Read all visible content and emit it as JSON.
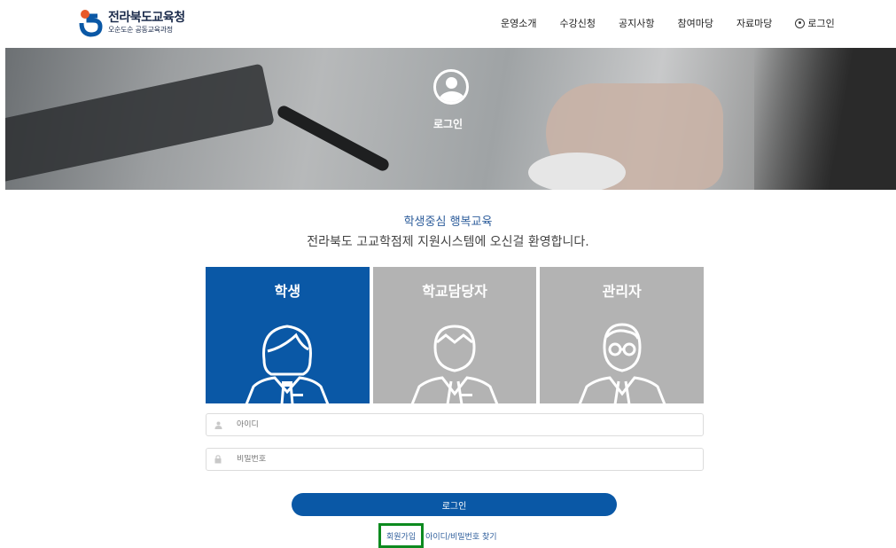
{
  "brand": {
    "title": "전라북도교육청",
    "subtitle": "오순도순 공동교육과정"
  },
  "nav": {
    "items": [
      "운영소개",
      "수강신청",
      "공지사항",
      "참여마당",
      "자료마당"
    ],
    "login_label": "로그인"
  },
  "hero": {
    "title": "로그인"
  },
  "welcome": {
    "line1": "학생중심 행복교육",
    "line2": "전라북도 고교학점제 지원시스템에 오신걸 환영합니다."
  },
  "user_types": [
    {
      "label": "학생",
      "selected": true
    },
    {
      "label": "학교담당자",
      "selected": false
    },
    {
      "label": "관리자",
      "selected": false
    }
  ],
  "form": {
    "id_placeholder": "아이디",
    "pw_placeholder": "비밀번호",
    "login_button": "로그인"
  },
  "links": {
    "signup": "회원가입",
    "find_account": "아이디/비밀번호 찾기"
  },
  "colors": {
    "primary": "#0a58a6",
    "card_inactive": "#b3b3b3",
    "highlight": "#0d8a1f"
  }
}
